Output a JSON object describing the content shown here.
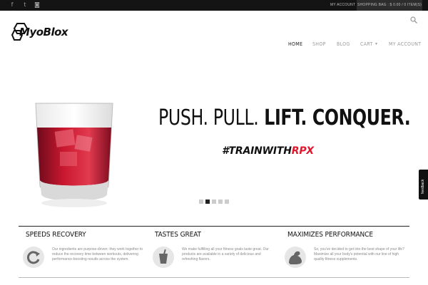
{
  "topbar": {
    "social": [
      {
        "icon": "facebook-icon",
        "glyph": "f"
      },
      {
        "icon": "twitter-icon",
        "glyph": "t"
      },
      {
        "icon": "instagram-icon",
        "glyph": "◙"
      }
    ],
    "my_account": "MY ACCOUNT",
    "shopping_bag": "SHOPPING BAG : $ 0.00 / 0 ITEM(S)"
  },
  "header": {
    "logo_text": "MyoBlox",
    "nav": [
      {
        "label": "HOME",
        "active": true
      },
      {
        "label": "SHOP",
        "active": false
      },
      {
        "label": "BLOG",
        "active": false
      },
      {
        "label": "CART",
        "active": false
      },
      {
        "label": "MY ACCOUNT",
        "active": false
      }
    ]
  },
  "hero": {
    "headline_part1": "PUSH. PULL.",
    "headline_part2": "LIFT. CONQUER.",
    "hashtag_prefix": "#TRAINWITH",
    "hashtag_suffix": "RPX",
    "slides_count": 5,
    "active_slide": 2
  },
  "feedback_tab": "feedback",
  "features": [
    {
      "title": "SPEEDS RECOVERY",
      "icon": "recovery-arrow-icon",
      "description": "Our ingredients are purpose-driven: they work together to reduce the recovery time between workouts, delivering performance-boosting results across the system."
    },
    {
      "title": "TASTES GREAT",
      "icon": "drink-cup-icon",
      "description": "We make fulfilling all your fitness goals taste great. Our products are available in a variety of delicious and refreshing flavors."
    },
    {
      "title": "MAXIMIZES PERFORMANCE",
      "icon": "flexed-arm-icon",
      "description": "So, you've decided to get into the best shape of your life? Maximize all your body's potential with our line of high quality fitness supplements."
    }
  ],
  "colors": {
    "accent_red": "#e1182d",
    "topbar": "#141414",
    "text_dark": "#111111",
    "muted": "#9c9c9c"
  }
}
